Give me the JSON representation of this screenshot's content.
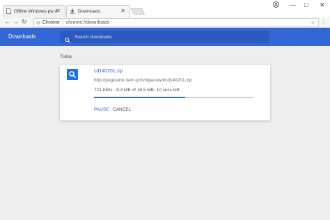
{
  "tabs": [
    {
      "label": "Offline Windows pw & re",
      "icon": "page-icon"
    },
    {
      "label": "Downloads",
      "icon": "download-icon"
    }
  ],
  "window_controls": {
    "user": "user-icon",
    "minimize": "—",
    "maximize": "□",
    "close": "✕"
  },
  "omnibox": {
    "scheme": "Chrome",
    "url": "chrome://downloads"
  },
  "header": {
    "title": "Downloads",
    "search_placeholder": "Search downloads"
  },
  "date_group": "Today",
  "download": {
    "file_name": "cd140201.zip",
    "url": "http://pogostick.net/~pnh/ntpasswd/cd140201.zip",
    "status": "721 KB/s - 9.4 MB of 16.5 MB, 10 secs left",
    "progress": 0.57,
    "pause_label": "PAUSE",
    "cancel_label": "CANCEL"
  },
  "colors": {
    "accent": "#3367d6",
    "file_icon": "#1a73e8"
  }
}
